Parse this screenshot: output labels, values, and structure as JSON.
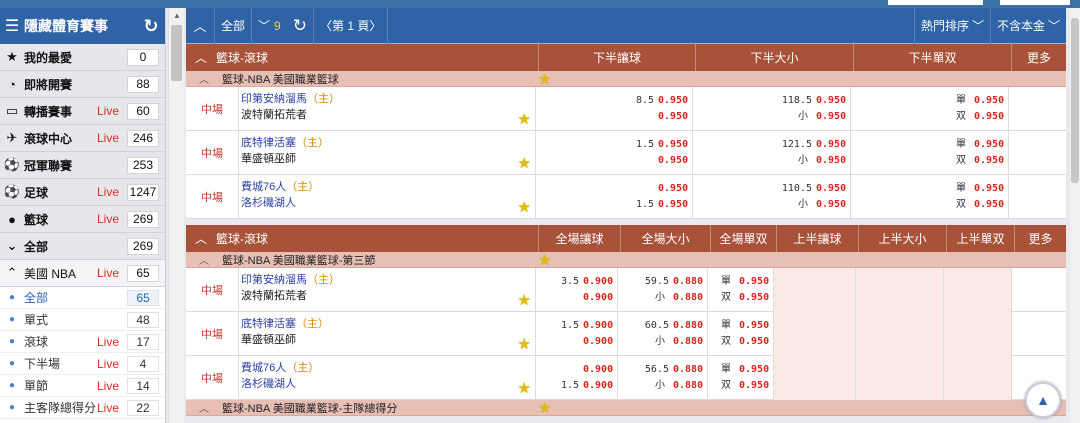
{
  "sidebar": {
    "title": "隱藏體育賽事",
    "rows": [
      {
        "icon": "★",
        "name": "favorites",
        "label": "我的最愛",
        "live": "",
        "count": "0"
      },
      {
        "icon": "◔",
        "name": "upcoming",
        "label": "即將開賽",
        "live": "",
        "count": "88"
      },
      {
        "icon": "▭",
        "name": "streaming",
        "label": "轉播賽事",
        "live": "Live",
        "count": "60"
      },
      {
        "icon": "✈",
        "name": "live-center",
        "label": "滾球中心",
        "live": "Live",
        "count": "246"
      },
      {
        "icon": "⚽",
        "name": "championship",
        "label": "冠軍聯賽",
        "live": "",
        "count": "253"
      },
      {
        "icon": "⚽",
        "name": "football",
        "label": "足球",
        "live": "Live",
        "count": "1247"
      },
      {
        "icon": "●",
        "name": "basketball",
        "label": "籃球",
        "live": "Live",
        "count": "269"
      },
      {
        "icon": "⌄",
        "name": "all",
        "label": "全部",
        "live": "",
        "count": "269"
      },
      {
        "icon": "⌃",
        "name": "nba",
        "label": "美國 NBA",
        "live": "Live",
        "count": "65"
      }
    ],
    "subs": [
      {
        "label": "全部",
        "live": "",
        "count": "65",
        "sel": true
      },
      {
        "label": "單式",
        "live": "",
        "count": "48"
      },
      {
        "label": "滾球",
        "live": "Live",
        "count": "17"
      },
      {
        "label": "下半場",
        "live": "Live",
        "count": "4"
      },
      {
        "label": "單節",
        "live": "Live",
        "count": "14"
      },
      {
        "label": "主客隊總得分",
        "live": "Live",
        "count": "22"
      }
    ]
  },
  "toolbar": {
    "all_label": "全部",
    "count": "9",
    "page_label": "第 1 頁",
    "sort_label": "熱門排序",
    "gold_label": "不含本金"
  },
  "blocks": [
    {
      "section": "籃球-滾球",
      "cols": [
        {
          "label": "下半讓球",
          "w": 157
        },
        {
          "label": "下半大小",
          "w": 158
        },
        {
          "label": "下半單双",
          "w": 158
        },
        {
          "label": "更多",
          "w": 55
        }
      ],
      "leagues": [
        {
          "title": "籃球-NBA 美國職業籃球",
          "rows": [
            {
              "time": "中場",
              "home": "印第安納溜馬",
              "away": "波特蘭拓荒者",
              "home_first": true,
              "cells": [
                [
                  [
                    "",
                    "8.5",
                    "0.950"
                  ],
                  [
                    "",
                    "",
                    "0.950"
                  ]
                ],
                [
                  [
                    "",
                    "118.5",
                    "0.950"
                  ],
                  [
                    "小",
                    "",
                    "0.950"
                  ]
                ],
                [
                  [
                    "單",
                    "",
                    "0.950"
                  ],
                  [
                    "双",
                    "",
                    "0.950"
                  ]
                ],
                []
              ]
            },
            {
              "time": "中場",
              "home": "底特律活塞",
              "away": "華盛頓巫師",
              "home_first": true,
              "cells": [
                [
                  [
                    "",
                    "1.5",
                    "0.950"
                  ],
                  [
                    "",
                    "",
                    "0.950"
                  ]
                ],
                [
                  [
                    "",
                    "121.5",
                    "0.950"
                  ],
                  [
                    "小",
                    "",
                    "0.950"
                  ]
                ],
                [
                  [
                    "單",
                    "",
                    "0.950"
                  ],
                  [
                    "双",
                    "",
                    "0.950"
                  ]
                ],
                []
              ]
            },
            {
              "time": "中場",
              "home": "費城76人",
              "away": "洛杉磯湖人",
              "home_first": true,
              "away_blue": true,
              "cells": [
                [
                  [
                    "",
                    "",
                    "0.950"
                  ],
                  [
                    "",
                    "1.5",
                    "0.950"
                  ]
                ],
                [
                  [
                    "",
                    "110.5",
                    "0.950"
                  ],
                  [
                    "小",
                    "",
                    "0.950"
                  ]
                ],
                [
                  [
                    "單",
                    "",
                    "0.950"
                  ],
                  [
                    "双",
                    "",
                    "0.950"
                  ]
                ],
                []
              ]
            }
          ]
        }
      ]
    },
    {
      "section": "籃球-滾球",
      "cols": [
        {
          "label": "全場讓球",
          "w": 82
        },
        {
          "label": "全場大小",
          "w": 90
        },
        {
          "label": "全場單双",
          "w": 66
        },
        {
          "label": "上半讓球",
          "w": 82
        },
        {
          "label": "上半大小",
          "w": 88
        },
        {
          "label": "上半單双",
          "w": 68
        },
        {
          "label": "更多",
          "w": 52
        }
      ],
      "leagues": [
        {
          "title": "籃球-NBA 美國職業籃球-第三節",
          "rows": [
            {
              "time": "中場",
              "home": "印第安納溜馬",
              "away": "波特蘭拓荒者",
              "cells": [
                [
                  [
                    "",
                    "3.5",
                    "0.900"
                  ],
                  [
                    "",
                    "",
                    "0.900"
                  ]
                ],
                [
                  [
                    "",
                    "59.5",
                    "0.880"
                  ],
                  [
                    "小",
                    "",
                    "0.880"
                  ]
                ],
                [
                  [
                    "單",
                    "",
                    "0.950"
                  ],
                  [
                    "双",
                    "",
                    "0.950"
                  ]
                ],
                [],
                [],
                [],
                []
              ]
            },
            {
              "time": "中場",
              "home": "底特律活塞",
              "away": "華盛頓巫師",
              "cells": [
                [
                  [
                    "",
                    "1.5",
                    "0.900"
                  ],
                  [
                    "",
                    "",
                    "0.900"
                  ]
                ],
                [
                  [
                    "",
                    "60.5",
                    "0.880"
                  ],
                  [
                    "小",
                    "",
                    "0.880"
                  ]
                ],
                [
                  [
                    "單",
                    "",
                    "0.950"
                  ],
                  [
                    "双",
                    "",
                    "0.950"
                  ]
                ],
                [],
                [],
                [],
                []
              ]
            },
            {
              "time": "中場",
              "home": "費城76人",
              "away": "洛杉磯湖人",
              "away_blue": true,
              "cells": [
                [
                  [
                    "",
                    "",
                    "0.900"
                  ],
                  [
                    "",
                    "1.5",
                    "0.900"
                  ]
                ],
                [
                  [
                    "",
                    "56.5",
                    "0.880"
                  ],
                  [
                    "小",
                    "",
                    "0.880"
                  ]
                ],
                [
                  [
                    "單",
                    "",
                    "0.950"
                  ],
                  [
                    "双",
                    "",
                    "0.950"
                  ]
                ],
                [],
                [],
                [],
                []
              ]
            }
          ]
        },
        {
          "title": "籃球-NBA 美國職業籃球-主隊總得分",
          "rows": []
        }
      ]
    }
  ],
  "host_tag": "（主）"
}
